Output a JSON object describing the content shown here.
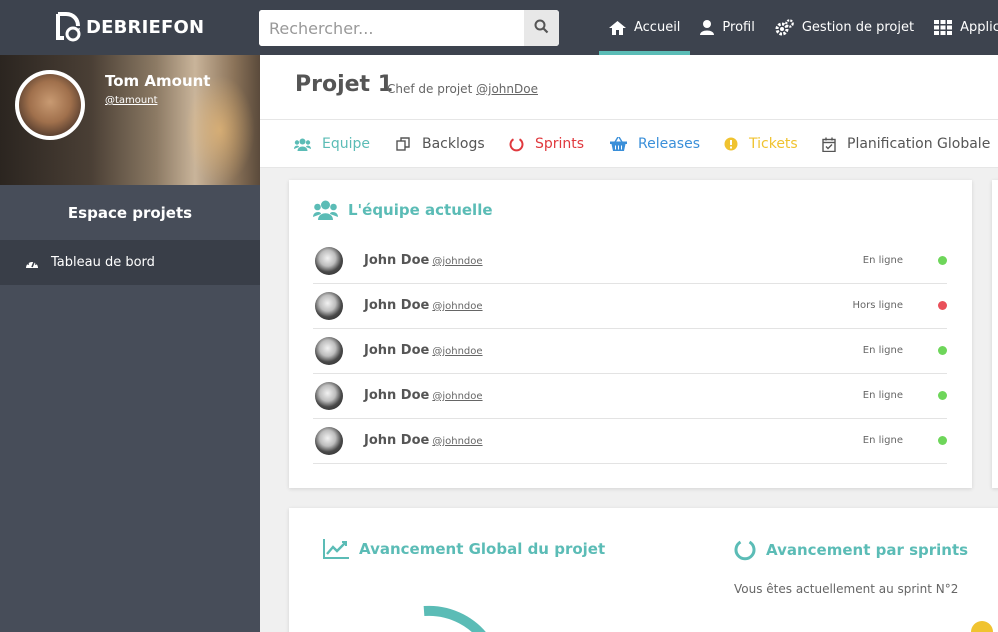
{
  "brand": {
    "name": "DEBRIEFON",
    "accent": "#5bbcb6"
  },
  "search": {
    "placeholder": "Rechercher..."
  },
  "nav": [
    {
      "label": "Accueil",
      "icon": "home-icon",
      "active": true
    },
    {
      "label": "Profil",
      "icon": "user-icon"
    },
    {
      "label": "Gestion de projet",
      "icon": "cogs-icon"
    },
    {
      "label": "Applic",
      "icon": "grid-icon"
    }
  ],
  "user": {
    "name": "Tom Amount",
    "handle": "@tamount"
  },
  "sidebar": {
    "section_title": "Espace projets",
    "items": [
      {
        "label": "Tableau de bord",
        "icon": "dashboard-icon"
      }
    ]
  },
  "project": {
    "title": "Projet 1",
    "manager_label": "Chef de projet",
    "manager_handle": "@johnDoe"
  },
  "tabs": [
    {
      "label": "Equipe",
      "icon": "users-icon",
      "color": "#5bbcb6"
    },
    {
      "label": "Backlogs",
      "icon": "copy-icon",
      "color": "#555555"
    },
    {
      "label": "Sprints",
      "icon": "circle-notch-icon",
      "color": "#e0393e"
    },
    {
      "label": "Releases",
      "icon": "basket-icon",
      "color": "#3a8fd9"
    },
    {
      "label": "Tickets",
      "icon": "exclamation-circle-icon",
      "color": "#f0c330"
    },
    {
      "label": "Planification Globale",
      "icon": "calendar-check-icon",
      "color": "#555555"
    }
  ],
  "team": {
    "title": "L'équipe actuelle",
    "members": [
      {
        "name": "John Doe",
        "handle": "@johndoe",
        "status": "En ligne",
        "status_color": "#6ed65a"
      },
      {
        "name": "John Doe",
        "handle": "@johndoe",
        "status": "Hors ligne",
        "status_color": "#e9505a"
      },
      {
        "name": "John Doe",
        "handle": "@johndoe",
        "status": "En ligne",
        "status_color": "#6ed65a"
      },
      {
        "name": "John Doe",
        "handle": "@johndoe",
        "status": "En ligne",
        "status_color": "#6ed65a"
      },
      {
        "name": "John Doe",
        "handle": "@johndoe",
        "status": "En ligne",
        "status_color": "#6ed65a"
      }
    ]
  },
  "progress": {
    "global_title": "Avancement Global du projet",
    "sprints_title": "Avancement par sprints",
    "sprint_text": "Vous êtes actuellement au sprint N°2"
  }
}
